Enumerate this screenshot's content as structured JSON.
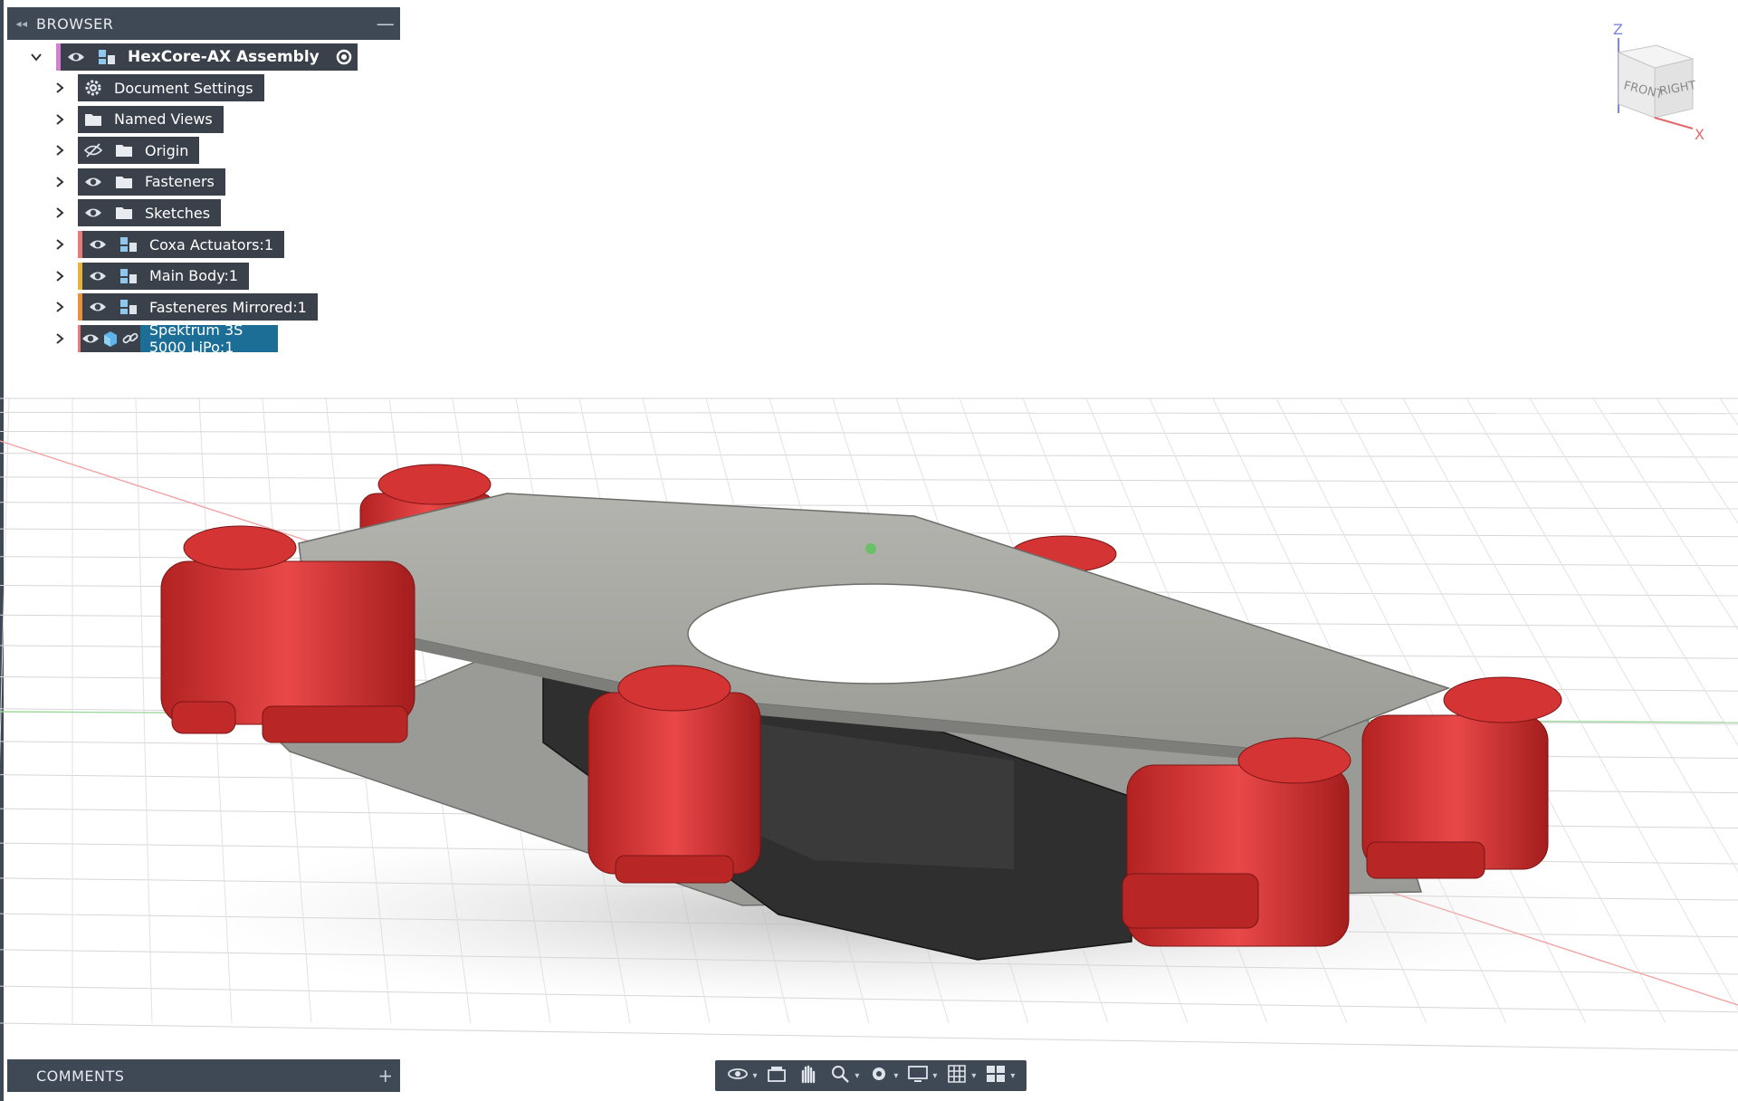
{
  "browser": {
    "header": "BROWSER",
    "collapse_glyph": "◂◂",
    "minimize_glyph": "—",
    "root": {
      "label": "HexCore-AX Assembly",
      "accent": "#d580d0"
    },
    "items": [
      {
        "label": "Document Settings",
        "icon": "gear-icon"
      },
      {
        "label": "Named Views",
        "icon": "folder-icon"
      },
      {
        "label": "Origin",
        "icon": "folder-icon",
        "visibility": "hidden"
      },
      {
        "label": "Fasteners",
        "icon": "folder-icon",
        "visibility": "visible"
      },
      {
        "label": "Sketches",
        "icon": "folder-icon",
        "visibility": "visible"
      },
      {
        "label": "Coxa Actuators:1",
        "icon": "component-icon",
        "accent": "#e57b7b"
      },
      {
        "label": "Main Body:1",
        "icon": "component-icon",
        "accent": "#e8b33a"
      },
      {
        "label": "Fasteneres Mirrored:1",
        "icon": "component-icon",
        "accent": "#e7923c"
      },
      {
        "label": "Spektrum 3S 5000 LiPo:1",
        "icon": "body-icon",
        "accent": "#e57b7b",
        "linked": true,
        "selected": true
      }
    ]
  },
  "comments": {
    "header": "COMMENTS",
    "add_glyph": "+"
  },
  "viewcube": {
    "front": "FRONT",
    "right": "RIGHT",
    "axis_z": "Z",
    "axis_x": "X"
  },
  "navbar": {
    "tools": [
      "orbit-icon",
      "look-at-icon",
      "pan-icon",
      "zoom-icon",
      "fit-icon",
      "display-icon",
      "grid-icon",
      "viewports-icon"
    ]
  },
  "colors": {
    "panel": "#3f4855",
    "pill": "#3a414b",
    "selected": "#1d6e96",
    "servo_red": "#d63a3a",
    "plate_gray": "#a8a8a3"
  }
}
